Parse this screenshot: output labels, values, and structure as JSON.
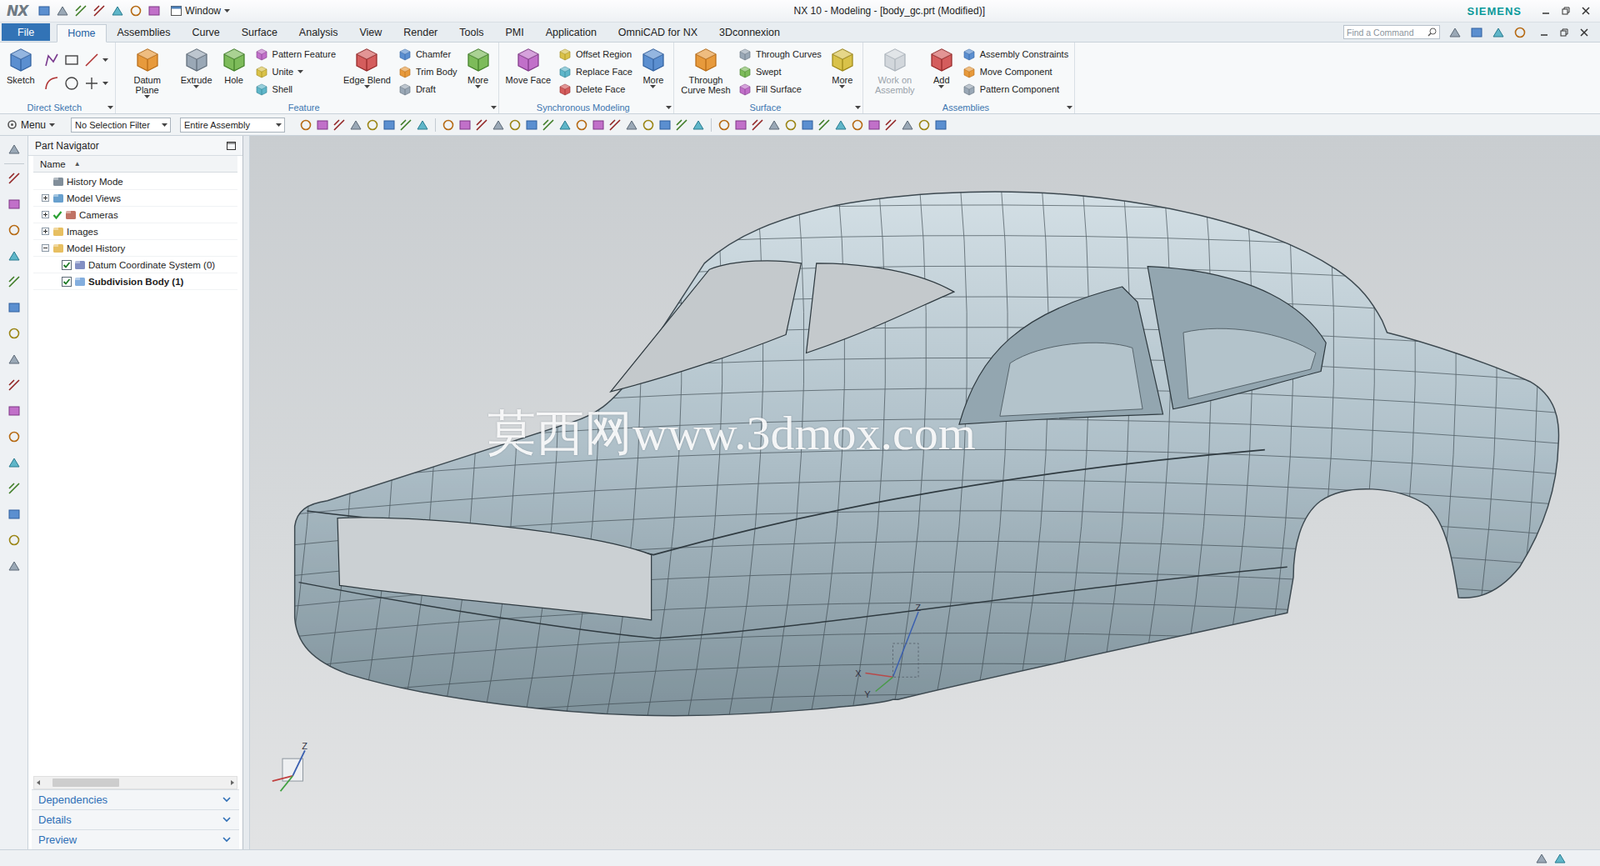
{
  "window": {
    "logo": "NX",
    "title": "NX 10 - Modeling - [body_gc.prt (Modified)]",
    "brand": "SIEMENS",
    "window_menu": "Window"
  },
  "tabs": [
    {
      "label": "File",
      "kind": "file",
      "selected": false
    },
    {
      "label": "Home",
      "kind": "tab",
      "selected": true
    },
    {
      "label": "Assemblies",
      "kind": "tab",
      "selected": false
    },
    {
      "label": "Curve",
      "kind": "tab",
      "selected": false
    },
    {
      "label": "Surface",
      "kind": "tab",
      "selected": false
    },
    {
      "label": "Analysis",
      "kind": "tab",
      "selected": false
    },
    {
      "label": "View",
      "kind": "tab",
      "selected": false
    },
    {
      "label": "Render",
      "kind": "tab",
      "selected": false
    },
    {
      "label": "Tools",
      "kind": "tab",
      "selected": false
    },
    {
      "label": "PMI",
      "kind": "tab",
      "selected": false
    },
    {
      "label": "Application",
      "kind": "tab",
      "selected": false
    },
    {
      "label": "OmniCAD for NX",
      "kind": "tab",
      "selected": false
    },
    {
      "label": "3Dconnexion",
      "kind": "tab",
      "selected": false
    }
  ],
  "search": {
    "placeholder": "Find a Command"
  },
  "ribbon": [
    {
      "title": "Direct Sketch",
      "columns": [
        {
          "kind": "large",
          "label": "Sketch",
          "dropdown": false,
          "disabled": false
        },
        {
          "kind": "sketch-tools"
        }
      ]
    },
    {
      "title": "Feature",
      "columns": [
        {
          "kind": "large",
          "label": "Datum Plane",
          "dropdown": true,
          "disabled": false
        },
        {
          "kind": "large",
          "label": "Extrude",
          "dropdown": true,
          "disabled": false
        },
        {
          "kind": "large",
          "label": "Hole",
          "dropdown": false,
          "disabled": false
        },
        {
          "kind": "stack",
          "items": [
            {
              "label": "Pattern Feature",
              "dropdown": false,
              "disabled": false
            },
            {
              "label": "Unite",
              "dropdown": true,
              "disabled": false
            },
            {
              "label": "Shell",
              "dropdown": false,
              "disabled": false
            }
          ]
        },
        {
          "kind": "large",
          "label": "Edge Blend",
          "dropdown": true,
          "disabled": false
        },
        {
          "kind": "stack",
          "items": [
            {
              "label": "Chamfer",
              "dropdown": false,
              "disabled": false
            },
            {
              "label": "Trim Body",
              "dropdown": false,
              "disabled": false
            },
            {
              "label": "Draft",
              "dropdown": false,
              "disabled": false
            }
          ]
        },
        {
          "kind": "large",
          "label": "More",
          "dropdown": true,
          "disabled": false
        }
      ]
    },
    {
      "title": "Synchronous Modeling",
      "columns": [
        {
          "kind": "large",
          "label": "Move Face",
          "dropdown": false,
          "disabled": false
        },
        {
          "kind": "stack",
          "items": [
            {
              "label": "Offset Region",
              "dropdown": false,
              "disabled": false
            },
            {
              "label": "Replace Face",
              "dropdown": false,
              "disabled": false
            },
            {
              "label": "Delete Face",
              "dropdown": false,
              "disabled": false
            }
          ]
        },
        {
          "kind": "large",
          "label": "More",
          "dropdown": true,
          "disabled": false
        }
      ]
    },
    {
      "title": "Surface",
      "columns": [
        {
          "kind": "large",
          "label": "Through Curve Mesh",
          "dropdown": false,
          "disabled": false
        },
        {
          "kind": "stack",
          "items": [
            {
              "label": "Through Curves",
              "dropdown": false,
              "disabled": false
            },
            {
              "label": "Swept",
              "dropdown": false,
              "disabled": false
            },
            {
              "label": "Fill Surface",
              "dropdown": false,
              "disabled": false
            }
          ]
        },
        {
          "kind": "large",
          "label": "More",
          "dropdown": true,
          "disabled": false
        }
      ]
    },
    {
      "title": "Assemblies",
      "columns": [
        {
          "kind": "large",
          "label": "Work on Assembly",
          "dropdown": false,
          "disabled": true
        },
        {
          "kind": "large",
          "label": "Add",
          "dropdown": true,
          "disabled": false
        },
        {
          "kind": "stack",
          "items": [
            {
              "label": "Assembly Constraints",
              "dropdown": false,
              "disabled": false
            },
            {
              "label": "Move Component",
              "dropdown": false,
              "disabled": false
            },
            {
              "label": "Pattern Component",
              "dropdown": false,
              "disabled": false
            }
          ]
        }
      ]
    }
  ],
  "selection_bar": {
    "menu": "Menu",
    "filters": [
      "No Selection Filter",
      "Entire Assembly"
    ]
  },
  "navigator": {
    "title": "Part Navigator",
    "column": "Name",
    "sort": "▲",
    "rows": [
      {
        "label": "History Mode",
        "level": 0,
        "expandable": false,
        "expanded": false,
        "mark": "none",
        "checked": false,
        "current": false
      },
      {
        "label": "Model Views",
        "level": 0,
        "expandable": true,
        "expanded": false,
        "mark": "none",
        "checked": false,
        "current": false
      },
      {
        "label": "Cameras",
        "level": 0,
        "expandable": true,
        "expanded": false,
        "mark": "tick",
        "checked": true,
        "current": false
      },
      {
        "label": "Images",
        "level": 0,
        "expandable": true,
        "expanded": false,
        "mark": "none",
        "checked": false,
        "current": false
      },
      {
        "label": "Model History",
        "level": 0,
        "expandable": true,
        "expanded": true,
        "mark": "none",
        "checked": false,
        "current": false
      },
      {
        "label": "Datum Coordinate System (0)",
        "level": 1,
        "expandable": false,
        "expanded": false,
        "mark": "checkbox",
        "checked": true,
        "current": false
      },
      {
        "label": "Subdivision Body (1)",
        "level": 1,
        "expandable": false,
        "expanded": false,
        "mark": "checkbox",
        "checked": true,
        "current": true
      }
    ],
    "sections": [
      {
        "label": "Dependencies",
        "expanded": false
      },
      {
        "label": "Details",
        "expanded": false
      },
      {
        "label": "Preview",
        "expanded": false
      }
    ]
  },
  "viewport": {
    "watermark": "莫西网www.3dmox.com",
    "csys_labels": {
      "x": "X",
      "y": "Y",
      "z": "Z"
    },
    "triad_label": "Z"
  }
}
